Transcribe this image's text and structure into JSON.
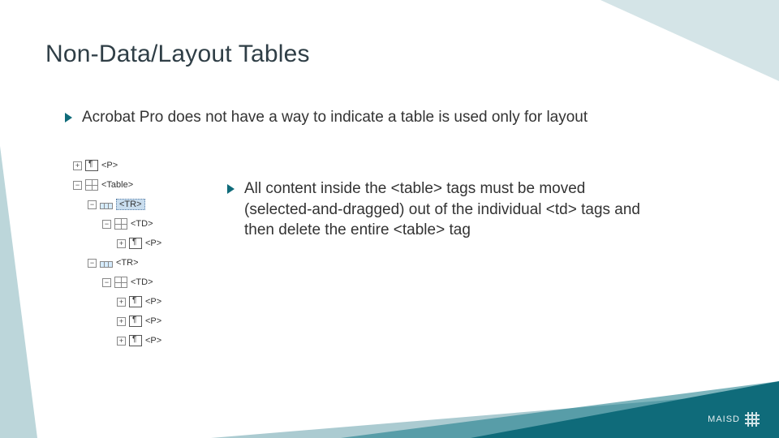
{
  "title": "Non-Data/Layout Tables",
  "bullets": {
    "b1": "Acrobat Pro does not have a way to indicate a table is used only for layout",
    "b2": "All content inside the <table> tags must be moved (selected-and-dragged) out of the individual <td> tags and then delete the entire <table> tag"
  },
  "tagtree": {
    "n0": "<P>",
    "n1": "<Table>",
    "n2": "<TR>",
    "n3": "<TD>",
    "n4": "<P>",
    "n5": "<TR>",
    "n6": "<TD>",
    "n7": "<P>",
    "n8": "<P>",
    "n9": "<P>",
    "plus": "+",
    "minus": "−"
  },
  "logo": {
    "text": "MAISD"
  }
}
